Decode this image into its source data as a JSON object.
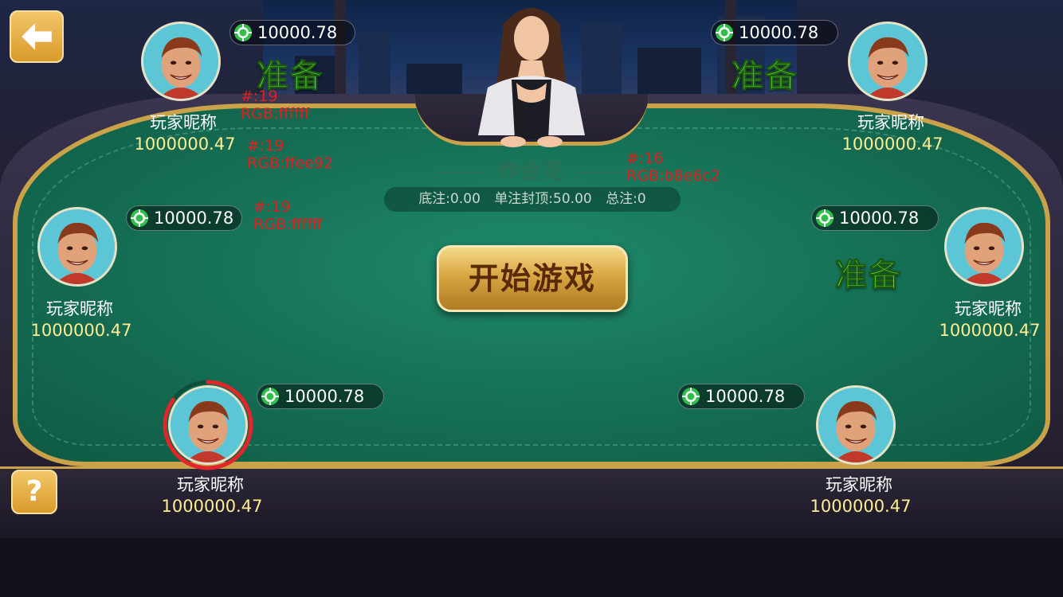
{
  "game": {
    "title": "炸金花",
    "bet_info": {
      "base": "底注:0.00",
      "cap": "单注封顶:50.00",
      "total": "总注:0"
    },
    "start_button": "开始游戏"
  },
  "players": [
    {
      "id": "top-left",
      "name": "玩家昵称",
      "balance": "1000000.47",
      "chips": "10000.78",
      "status": "准备"
    },
    {
      "id": "top-right",
      "name": "玩家昵称",
      "balance": "1000000.47",
      "chips": "10000.78",
      "status": "准备"
    },
    {
      "id": "mid-left",
      "name": "玩家昵称",
      "balance": "1000000.47",
      "chips": "10000.78",
      "status": ""
    },
    {
      "id": "mid-right",
      "name": "玩家昵称",
      "balance": "1000000.47",
      "chips": "10000.78",
      "status": "准备"
    },
    {
      "id": "bottom-left",
      "name": "玩家昵称",
      "balance": "1000000.47",
      "chips": "10000.78",
      "status": ""
    },
    {
      "id": "bottom-right",
      "name": "玩家昵称",
      "balance": "1000000.47",
      "chips": "10000.78",
      "status": ""
    }
  ],
  "annotations": [
    {
      "size": "#:19",
      "rgb": "RGB:ffffff"
    },
    {
      "size": "#:19",
      "rgb": "RGB:ffee92"
    },
    {
      "size": "#:16",
      "rgb": "RGB:b8e6c2"
    },
    {
      "size": "#:19",
      "rgb": "RGB:ffffff"
    }
  ],
  "buttons": {
    "back_icon": "back-arrow-icon",
    "help_label": "?"
  },
  "colors": {
    "name": "#ffffff",
    "balance": "#ffee92",
    "title": "#b8e6c2",
    "ready": "#5ce03a",
    "felt": "#167257",
    "rail_gold": "#c9a24a"
  },
  "timer": {
    "progress": 0.85
  }
}
